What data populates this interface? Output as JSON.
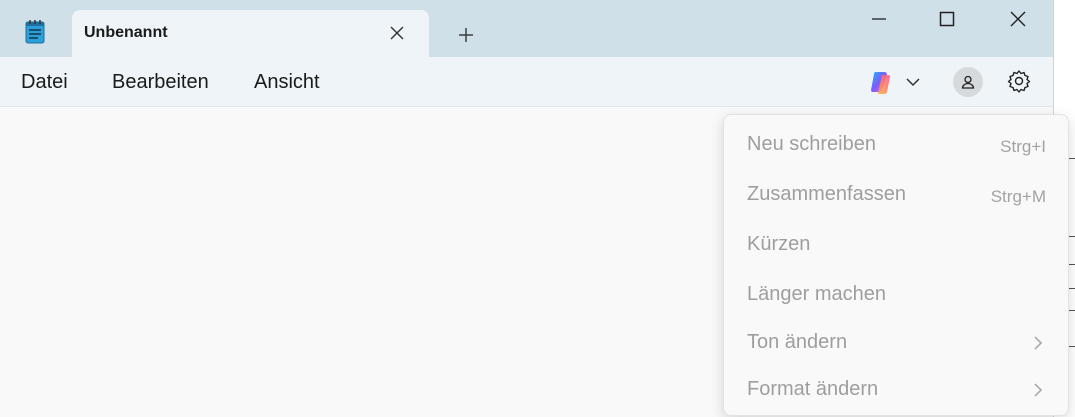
{
  "tab": {
    "title": "Unbenannt"
  },
  "menu": {
    "file": "Datei",
    "edit": "Bearbeiten",
    "view": "Ansicht"
  },
  "dropdown": {
    "items": [
      {
        "label": "Neu schreiben",
        "shortcut": "Strg+I"
      },
      {
        "label": "Zusammenfassen",
        "shortcut": "Strg+M"
      },
      {
        "label": "Kürzen"
      },
      {
        "label": "Länger machen"
      },
      {
        "label": "Ton ändern",
        "submenu": true
      },
      {
        "label": "Format ändern",
        "submenu": true
      }
    ]
  },
  "icons": {
    "app": "notepad-icon",
    "tab_close": "close-icon",
    "new_tab": "plus-icon",
    "minimize": "minimize-icon",
    "maximize": "maximize-icon",
    "close": "close-icon",
    "copilot": "copilot-icon",
    "copilot_menu": "chevron-down-icon",
    "account": "account-icon",
    "settings": "gear-icon"
  },
  "colors": {
    "titlebar": "#cfe0e8",
    "tab": "#eef4f7",
    "disabled_text": "#9e9e9e"
  }
}
